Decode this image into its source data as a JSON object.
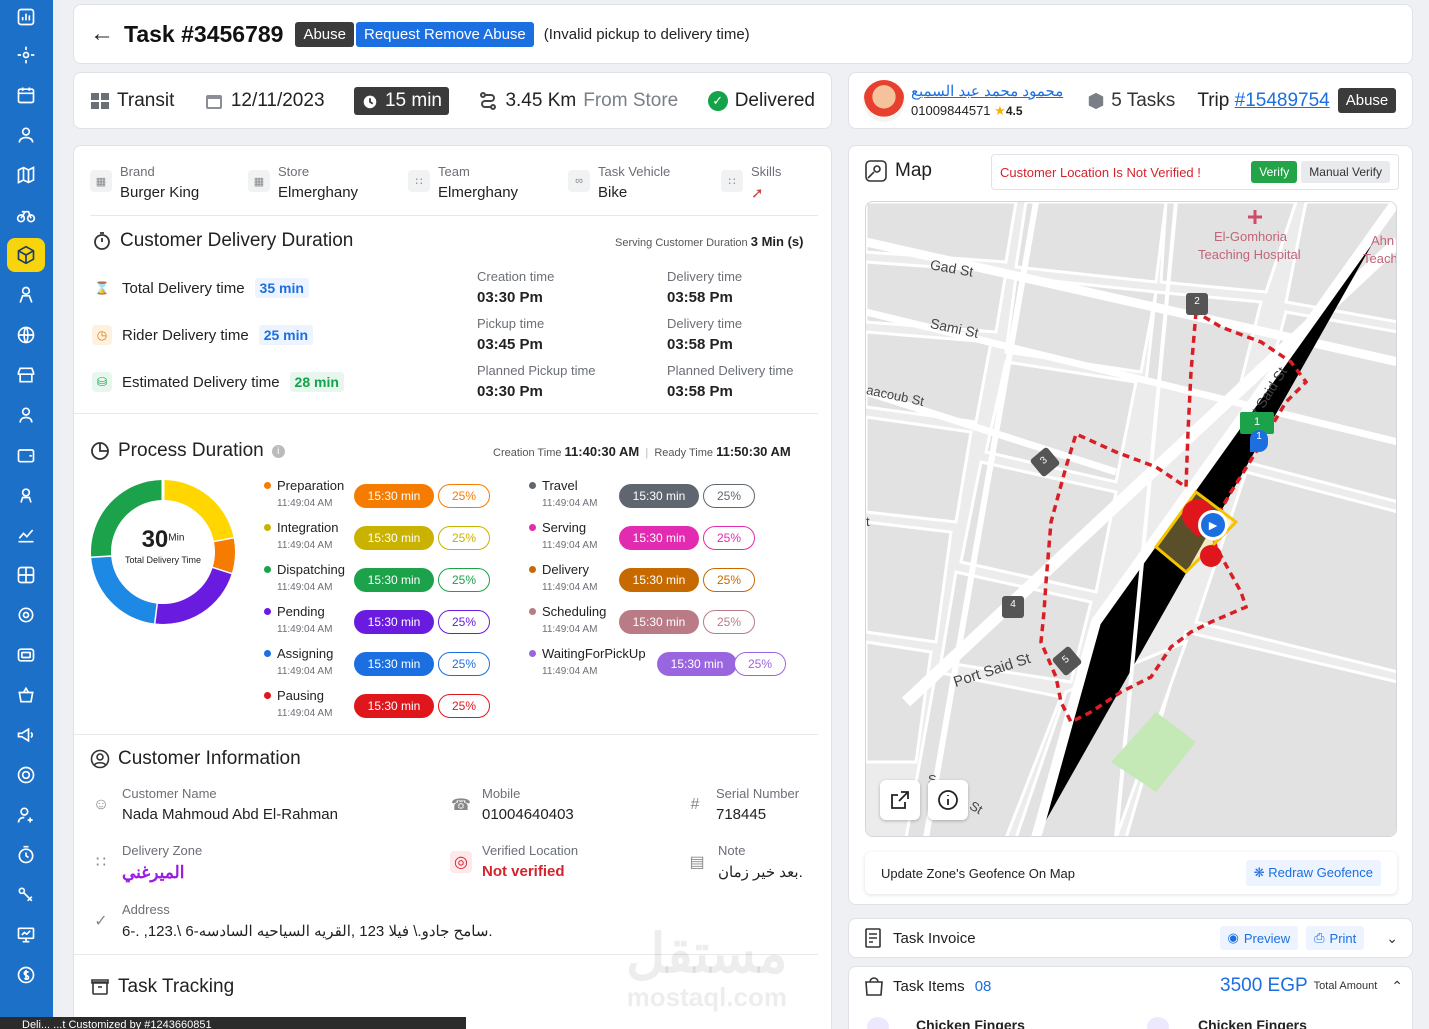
{
  "header": {
    "title": "Task #3456789",
    "abuse_badge": "Abuse",
    "request_remove": "Request Remove Abuse",
    "note": "(Invalid pickup to delivery time)"
  },
  "summary": {
    "status": "Transit",
    "date": "12/11/2023",
    "duration": "15 min",
    "distance": "3.45 Km",
    "distance_suffix": "From Store",
    "state": "Delivered"
  },
  "rider": {
    "name": "محمود محمد عبد السميع",
    "phone": "01009844571",
    "rating": "4.5",
    "tasks": "5 Tasks",
    "trip_label": "Trip",
    "trip_id": "#15489754",
    "abuse_badge": "Abuse"
  },
  "meta": [
    {
      "label": "Brand",
      "value": "Burger King"
    },
    {
      "label": "Store",
      "value": "Elmerghany"
    },
    {
      "label": "Team",
      "value": "Elmerghany"
    },
    {
      "label": "Task Vehicle",
      "value": "Bike"
    },
    {
      "label": "Skills",
      "value": ""
    }
  ],
  "delivery": {
    "title": "Customer Delivery Duration",
    "serving_label": "Serving Customer Duration",
    "serving_value": "3 Min (s)",
    "rows": [
      {
        "label": "Total Delivery time",
        "value": "35 min",
        "color": "#1b6fe0",
        "bg": "#eef4ff"
      },
      {
        "label": "Rider Delivery time",
        "value": "25 min",
        "color": "#1b6fe0",
        "bg": "#eef4ff"
      },
      {
        "label": "Estimated Delivery time",
        "value": "28 min",
        "color": "#14a34a",
        "bg": "#e8f7ed"
      }
    ],
    "times": [
      {
        "label": "Creation time",
        "value": "03:30 Pm"
      },
      {
        "label": "Delivery time",
        "value": "03:58 Pm"
      },
      {
        "label": "Pickup time",
        "value": "03:45 Pm"
      },
      {
        "label": "Delivery time",
        "value": "03:58 Pm"
      },
      {
        "label": "Planned Pickup time",
        "value": "03:30 Pm"
      },
      {
        "label": "Planned Delivery time",
        "value": "03:58 Pm"
      }
    ]
  },
  "process": {
    "title": "Process Duration",
    "creation_label": "Creation Time",
    "creation_value": "11:40:30 AM",
    "ready_label": "Ready Time",
    "ready_value": "11:50:30 AM",
    "donut_value": "30",
    "donut_unit": "Min",
    "donut_label": "Total Delivery Time",
    "donut_segments": [
      {
        "color": "#ffd600",
        "fraction": 0.22
      },
      {
        "color": "#f57c00",
        "fraction": 0.08
      },
      {
        "color": "#6a1be0",
        "fraction": 0.22
      },
      {
        "color": "#1e88e5",
        "fraction": 0.22
      },
      {
        "color": "#1ba24a",
        "fraction": 0.26
      }
    ],
    "steps": [
      {
        "name": "Preparation",
        "time": "11:49:04 AM",
        "duration": "15:30 min",
        "pct": "25%",
        "color": "#f57c00",
        "pctBorder": "#f57c00"
      },
      {
        "name": "Integration",
        "time": "11:49:04 AM",
        "duration": "15:30 min",
        "pct": "25%",
        "color": "#c9b200",
        "pctBorder": "#c9b200"
      },
      {
        "name": "Dispatching",
        "time": "11:49:04 AM",
        "duration": "15:30 min",
        "pct": "25%",
        "color": "#1ba24a",
        "pctBorder": "#1ba24a"
      },
      {
        "name": "Pending",
        "time": "11:49:04 AM",
        "duration": "15:30 min",
        "pct": "25%",
        "color": "#6a1be0",
        "pctBorder": "#6a1be0"
      },
      {
        "name": "Assigning",
        "time": "11:49:04 AM",
        "duration": "15:30 min",
        "pct": "25%",
        "color": "#1b6fe0",
        "pctBorder": "#1b6fe0"
      },
      {
        "name": "Pausing",
        "time": "11:49:04 AM",
        "duration": "15:30 min",
        "pct": "25%",
        "color": "#e0161d",
        "pctBorder": "#e0161d"
      },
      {
        "name": "Travel",
        "time": "11:49:04 AM",
        "duration": "15:30 min",
        "pct": "25%",
        "color": "#5f6670",
        "pctBorder": "#5f6670"
      },
      {
        "name": "Serving",
        "time": "11:49:04 AM",
        "duration": "15:30 min",
        "pct": "25%",
        "color": "#e22bb0",
        "pctBorder": "#e22bb0"
      },
      {
        "name": "Delivery",
        "time": "11:49:04 AM",
        "duration": "15:30 min",
        "pct": "25%",
        "color": "#c66a00",
        "pctBorder": "#c66a00"
      },
      {
        "name": "Scheduling",
        "time": "11:49:04 AM",
        "duration": "15:30 min",
        "pct": "25%",
        "color": "#b97b86",
        "pctBorder": "#b97b86"
      },
      {
        "name": "WaitingForPickUp",
        "time": "11:49:04 AM",
        "duration": "15:30 min",
        "pct": "25%",
        "color": "#9a66e0",
        "pctBorder": "#9a66e0"
      }
    ]
  },
  "customer": {
    "title": "Customer Information",
    "name_label": "Customer Name",
    "name": "Nada Mahmoud Abd El-Rahman",
    "mobile_label": "Mobile",
    "mobile": "01004640403",
    "serial_label": "Serial Number",
    "serial": "718445",
    "zone_label": "Delivery Zone",
    "zone": "الميرغني",
    "verified_label": "Verified Location",
    "verified": "Not verified",
    "note_label": "Note",
    "note": "بعد خير زمان.",
    "address_label": "Address",
    "address": "6-. ,123.\\ سامح جادو.\\ فيلا 123 ,القريه السياحيه السادسه-6."
  },
  "tracking": {
    "title": "Task Tracking"
  },
  "map": {
    "title": "Map",
    "warning": "Customer Location Is Not Verified !",
    "verify": "Verify",
    "manual_verify": "Manual Verify",
    "geofence_label": "Update Zone's Geofence On Map",
    "redraw": "Redraw Geofence",
    "labels": [
      "Gad St",
      "Sami St",
      "aacoub St",
      "Port Said St",
      "Port Said St",
      "El-Gomhoria",
      "Teaching Hospital",
      "Ahn",
      "Teach",
      "t",
      "S",
      "St"
    ],
    "markers": [
      "1",
      "1",
      "2",
      "3",
      "4",
      "5"
    ]
  },
  "invoice": {
    "title": "Task Invoice",
    "preview": "Preview",
    "print": "Print"
  },
  "items": {
    "title": "Task Items",
    "count": "08",
    "amount": "3500 EGP",
    "amount_label": "Total Amount",
    "names": [
      "Chicken Fingers",
      "Chicken Fingers"
    ]
  },
  "toast": "Deli... ...t Customized by #1243660851",
  "watermark": {
    "ar": "مستقل",
    "en": "mostaql.com"
  }
}
